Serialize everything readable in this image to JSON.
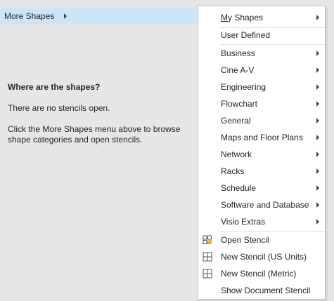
{
  "pane": {
    "more_shapes_label": "More Shapes",
    "empty_title": "Where are the shapes?",
    "empty_line1": "There are no stencils open.",
    "empty_line2": "Click the More Shapes menu above to browse shape categories and open stencils."
  },
  "menu": {
    "my_shapes_first": "M",
    "my_shapes_rest": "y Shapes",
    "user_defined": "User Defined",
    "categories": [
      "Business",
      "Cine A-V",
      "Engineering",
      "Flowchart",
      "General",
      "Maps and Floor Plans",
      "Network",
      "Racks",
      "Schedule",
      "Software and Database",
      "Visio Extras"
    ],
    "open_stencil": "Open Stencil",
    "new_stencil_us": "New Stencil (US Units)",
    "new_stencil_metric": "New Stencil (Metric)",
    "show_document_stencil": "Show Document Stencil"
  },
  "icons": {
    "submenu_arrow": "chevron-right-icon",
    "open_stencil": "open-stencil-icon",
    "new_stencil": "new-stencil-icon"
  },
  "colors": {
    "selected_bar": "#cce4f7",
    "pane_bg": "#e6e6e6"
  }
}
